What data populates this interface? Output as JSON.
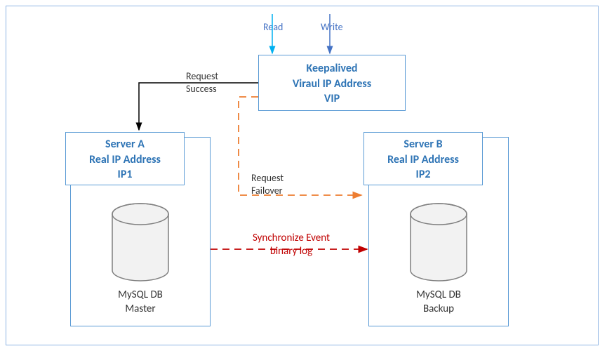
{
  "top": {
    "read_label": "Read",
    "write_label": "Write"
  },
  "vip": {
    "line1": "Keepalived",
    "line2": "Viraul IP Address",
    "line3": "VIP"
  },
  "serverA": {
    "line1": "Server A",
    "line2": "Real IP Address",
    "line3": "IP1",
    "db_line1": "MySQL DB",
    "db_line2": "Master"
  },
  "serverB": {
    "line1": "Server B",
    "line2": "Real IP Address",
    "line3": "IP2",
    "db_line1": "MySQL DB",
    "db_line2": "Backup"
  },
  "labels": {
    "request_success_line1": "Request",
    "request_success_line2": "Success",
    "request_failover_line1": "Request",
    "request_failover_line2": "Failover",
    "sync_line1": "Synchronize Event",
    "sync_line2": "binary log"
  },
  "chart_data": {
    "type": "diagram",
    "nodes": [
      {
        "id": "vip",
        "label": "Keepalived Viraul IP Address VIP"
      },
      {
        "id": "serverA",
        "label": "Server A Real IP Address IP1",
        "db": "MySQL DB Master"
      },
      {
        "id": "serverB",
        "label": "Server B Real IP Address IP2",
        "db": "MySQL DB Backup"
      }
    ],
    "edges": [
      {
        "from": "external",
        "to": "vip",
        "label": "Read",
        "style": "solid"
      },
      {
        "from": "external",
        "to": "vip",
        "label": "Write",
        "style": "solid"
      },
      {
        "from": "vip",
        "to": "serverA",
        "label": "Request Success",
        "style": "solid"
      },
      {
        "from": "vip",
        "to": "serverB",
        "label": "Request Failover",
        "style": "dashed"
      },
      {
        "from": "serverA",
        "to": "serverB",
        "label": "Synchronize Event binary log",
        "style": "dashed"
      }
    ]
  }
}
